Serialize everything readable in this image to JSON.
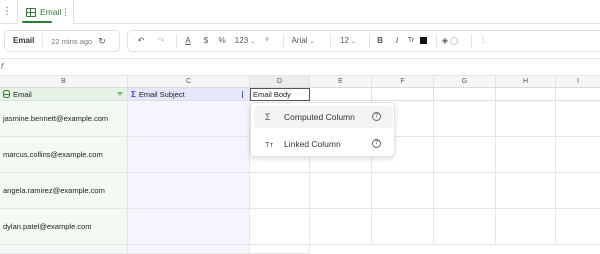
{
  "tabbar": {
    "tab": {
      "label": "Email",
      "active": true
    }
  },
  "toolbar": {
    "sheet_name": "Email",
    "last_saved": "22 mins ago",
    "number_format": "123",
    "font": "Arial",
    "font_size": "12",
    "text_color": "#111111"
  },
  "columns": [
    "B",
    "C",
    "D",
    "E",
    "F",
    "G",
    "H",
    "I"
  ],
  "fields": {
    "email": "Email",
    "subject": "Email Subject",
    "body": "Email Body"
  },
  "rows": [
    {
      "email": "jasmine.bennett@example.com",
      "subject": "",
      "body": ""
    },
    {
      "email": "marcus.collins@example.com",
      "subject": "",
      "body": ""
    },
    {
      "email": "angela.ramirez@example.com",
      "subject": "",
      "body": ""
    },
    {
      "email": "dylan.patel@example.com",
      "subject": "",
      "body": ""
    }
  ],
  "menu": {
    "items": [
      {
        "label": "Computed Column",
        "icon": "sigma-icon"
      },
      {
        "label": "Linked Column",
        "icon": "text-type-icon"
      }
    ]
  },
  "colors": {
    "accent_green": "#2e7d32",
    "email_column_bg": "#e6f2e6",
    "subject_column_bg": "#e5e7fb"
  }
}
